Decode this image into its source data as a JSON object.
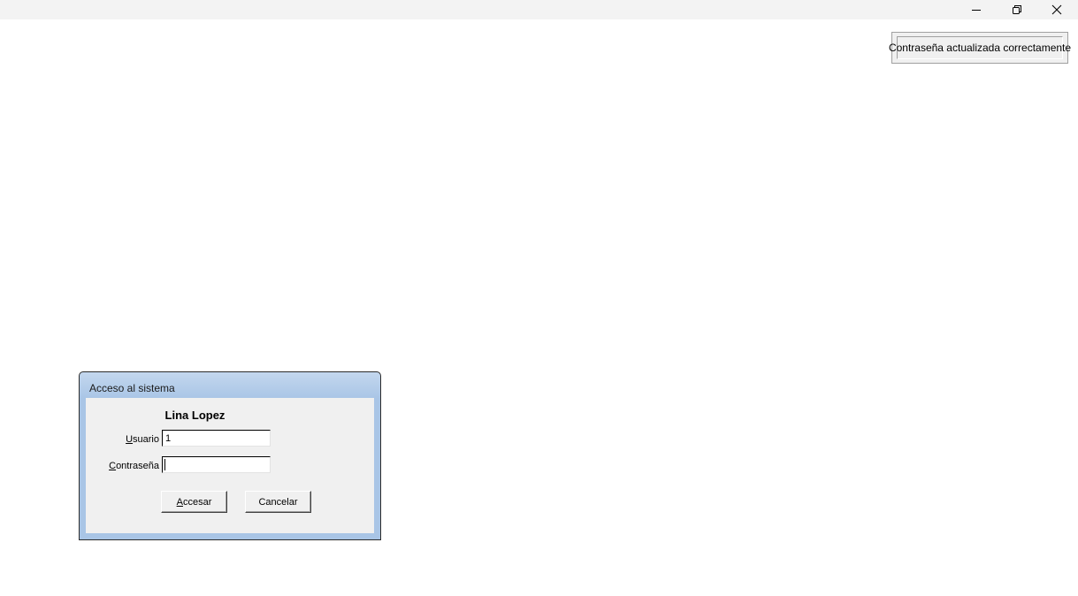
{
  "window": {
    "minimize_icon": "minimize-icon",
    "maximize_icon": "restore-icon",
    "close_icon": "close-icon"
  },
  "notification": {
    "text": "Contraseña actualizada correctamente"
  },
  "login_dialog": {
    "title": "Acceso al sistema",
    "user_name": "Lina Lopez",
    "usuario_label_first": "U",
    "usuario_label_rest": "suario",
    "usuario_value": "1",
    "contrasena_label_first": "C",
    "contrasena_label_rest": "ontraseña",
    "contrasena_value": "",
    "accesar_first": "A",
    "accesar_rest": "ccesar",
    "cancelar_label": "Cancelar"
  },
  "colors": {
    "dialog_frame": "#a9c5e6",
    "dialog_body": "#f0f0f0",
    "titlebar": "#f3f3f3"
  }
}
